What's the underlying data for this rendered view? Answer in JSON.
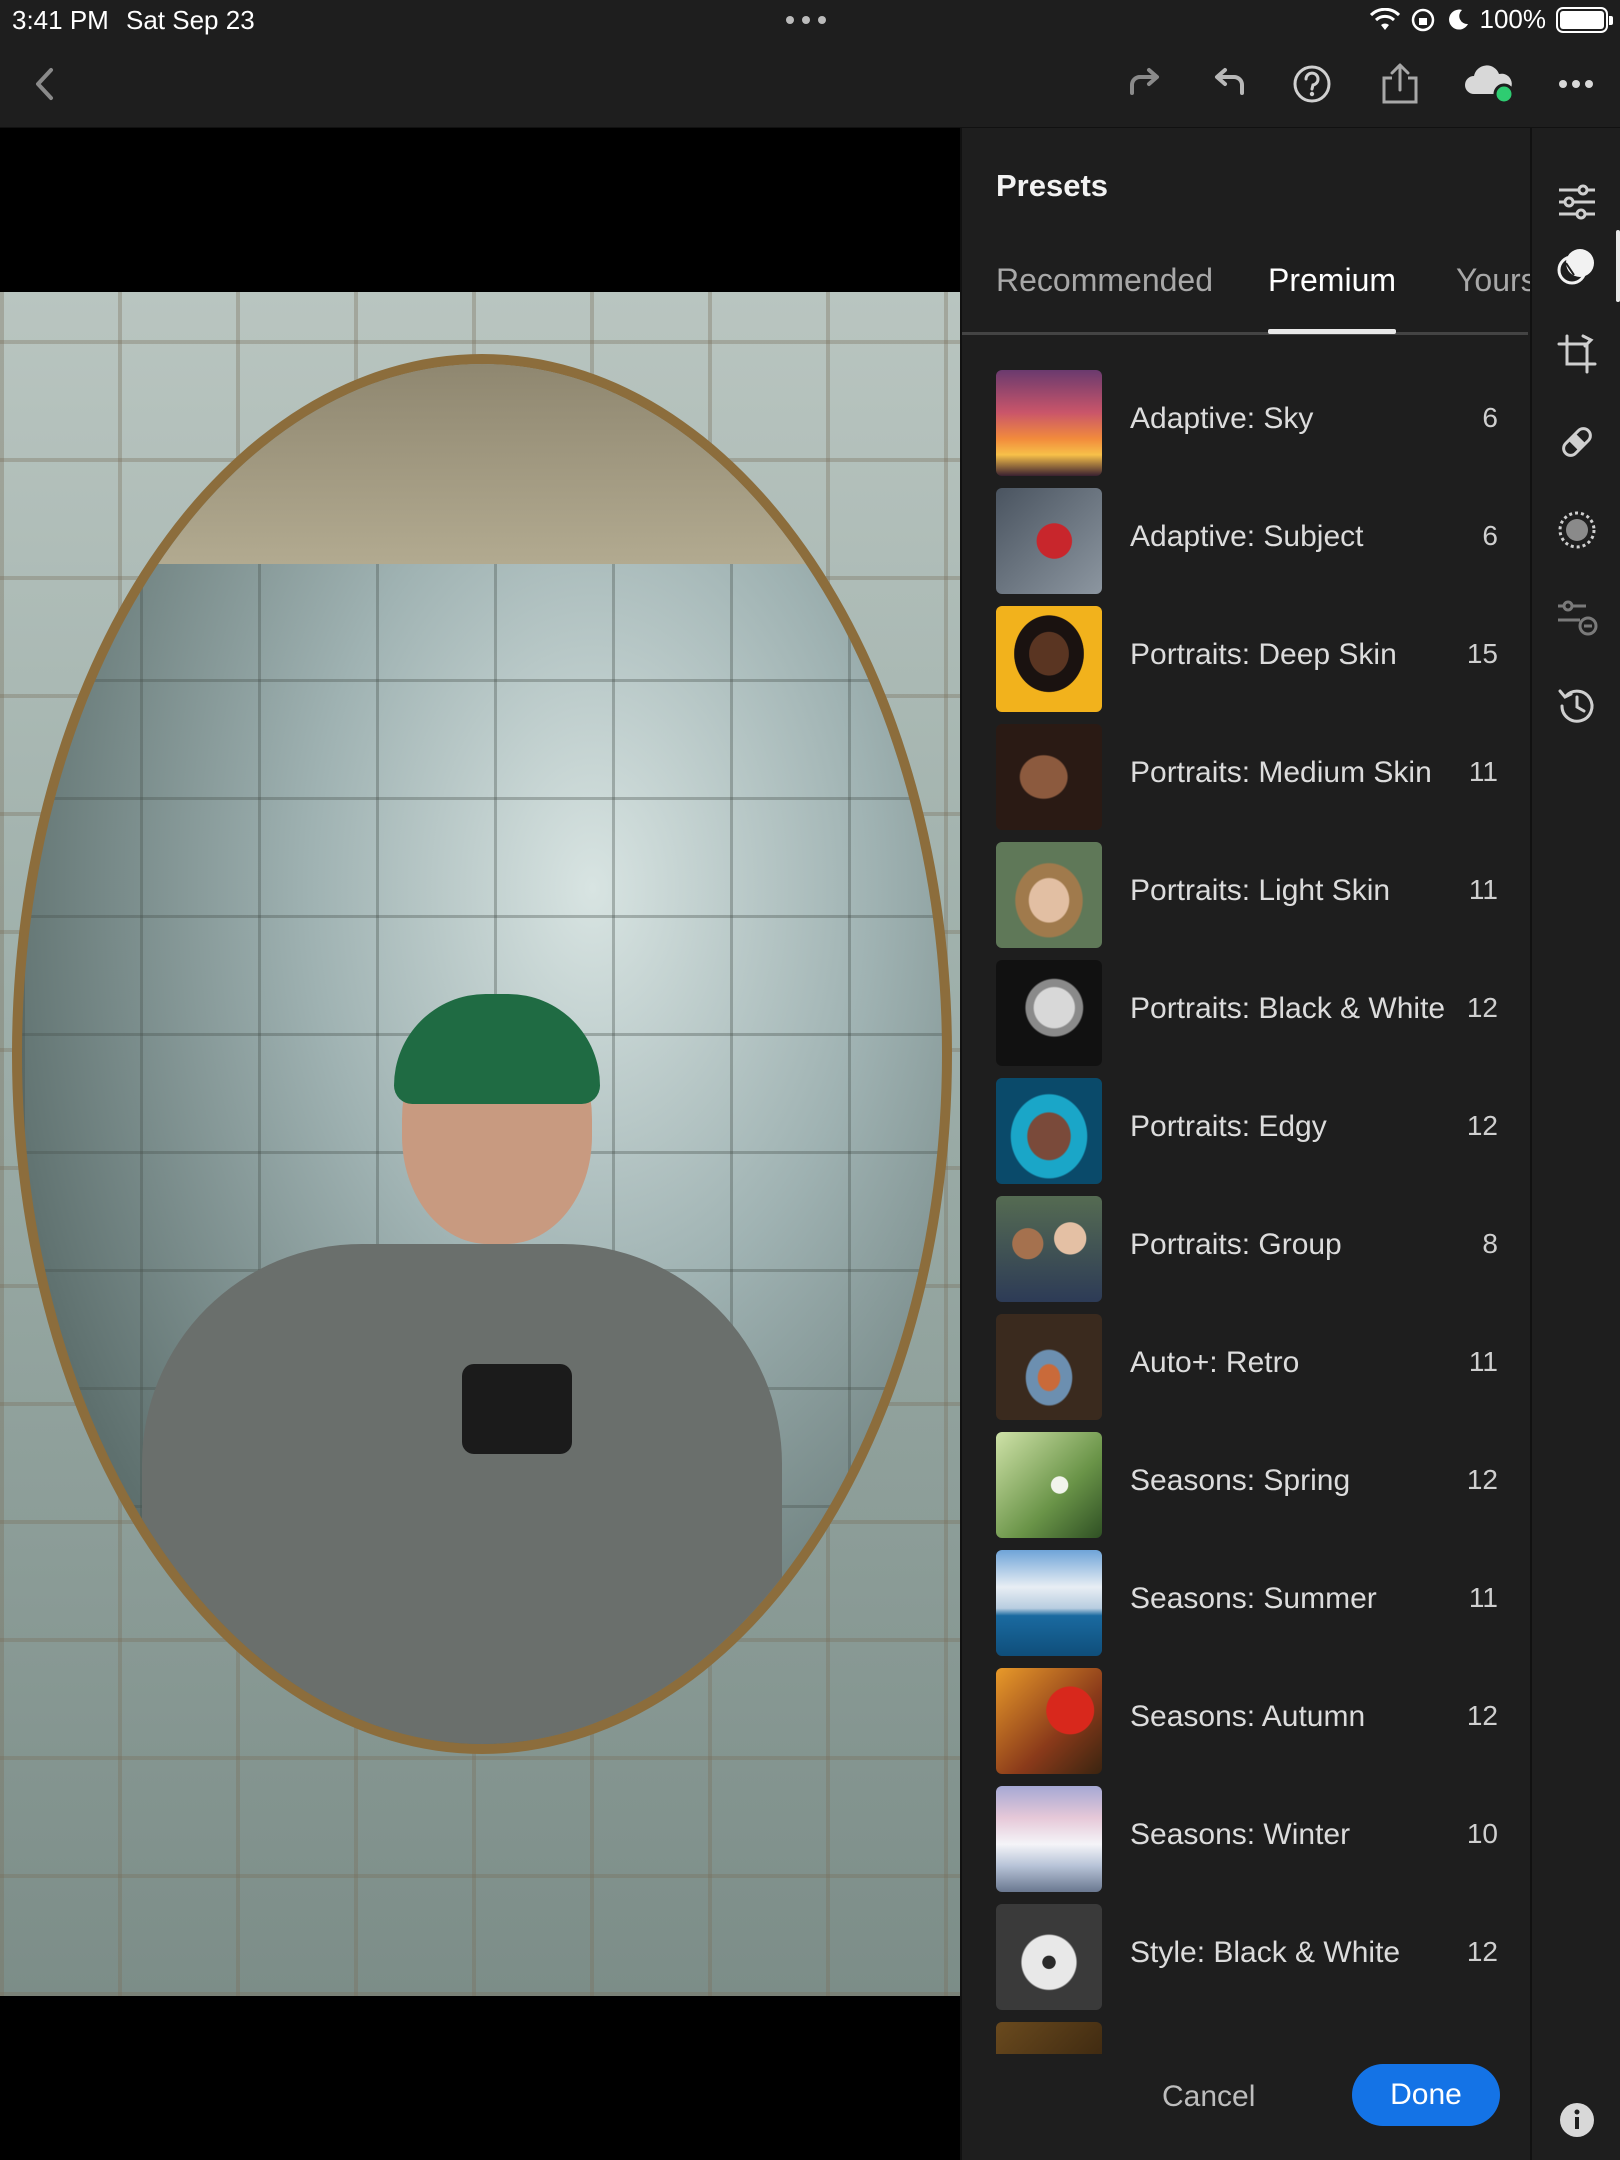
{
  "status_bar": {
    "time": "3:41 PM",
    "date": "Sat Sep 23",
    "battery": "100%"
  },
  "toolbar": {
    "icons": [
      "back-chevron-icon",
      "redo-icon",
      "undo-icon",
      "help-icon",
      "share-icon",
      "cloud-sync-icon",
      "more-icon"
    ],
    "sync_status_color": "#2ecc71"
  },
  "panel": {
    "title": "Presets",
    "tabs": [
      {
        "label": "Recommended",
        "active": false
      },
      {
        "label": "Premium",
        "active": true
      },
      {
        "label": "Yours",
        "active": false
      }
    ],
    "presets": [
      {
        "name": "Adaptive: Sky",
        "count": "6"
      },
      {
        "name": "Adaptive: Subject",
        "count": "6"
      },
      {
        "name": "Portraits: Deep Skin",
        "count": "15"
      },
      {
        "name": "Portraits: Medium Skin",
        "count": "11"
      },
      {
        "name": "Portraits: Light Skin",
        "count": "11"
      },
      {
        "name": "Portraits: Black & White",
        "count": "12"
      },
      {
        "name": "Portraits: Edgy",
        "count": "12"
      },
      {
        "name": "Portraits: Group",
        "count": "8"
      },
      {
        "name": "Auto+: Retro",
        "count": "11"
      },
      {
        "name": "Seasons: Spring",
        "count": "12"
      },
      {
        "name": "Seasons: Summer",
        "count": "11"
      },
      {
        "name": "Seasons: Autumn",
        "count": "12"
      },
      {
        "name": "Seasons: Winter",
        "count": "10"
      },
      {
        "name": "Style: Black & White",
        "count": "12"
      }
    ],
    "cancel_label": "Cancel",
    "done_label": "Done",
    "accent_color": "#1473e6"
  },
  "rail": {
    "icons": [
      "edit-sliders-icon",
      "presets-icon",
      "crop-icon",
      "healing-icon",
      "masking-icon",
      "versions-icon",
      "history-icon",
      "info-icon"
    ],
    "active": "presets-icon"
  }
}
